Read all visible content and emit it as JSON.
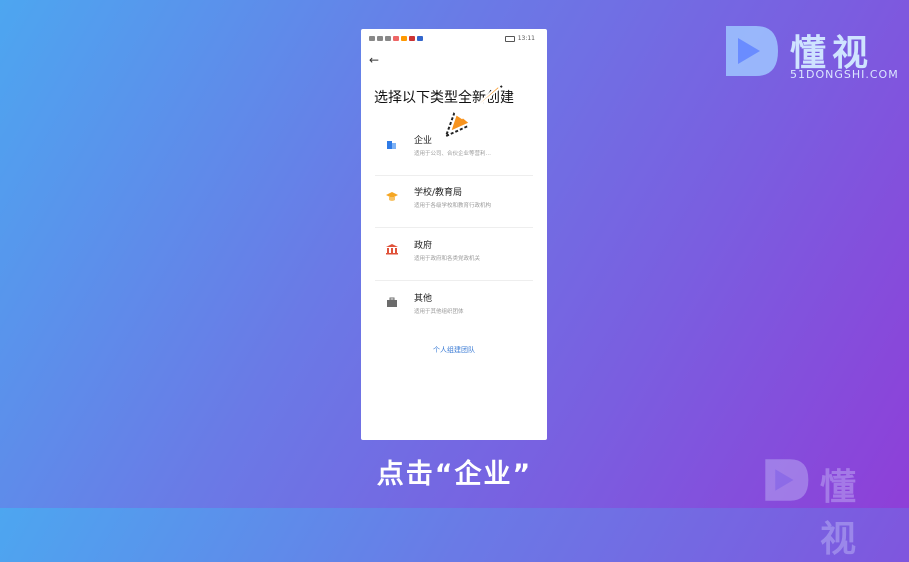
{
  "logo": {
    "text": "懂视",
    "sub": "51DONGSHI.COM"
  },
  "watermark": {
    "text": "懂视"
  },
  "phone": {
    "status_time": "13:11",
    "heading": "选择以下类型全新创建",
    "items": [
      {
        "title": "企业",
        "desc": "适用于公司、合伙企业等营利…",
        "icon": "building-icon",
        "icon_color": "#2f7be6"
      },
      {
        "title": "学校/教育局",
        "desc": "适用于各级学校和教育行政机构",
        "icon": "graduation-cap-icon",
        "icon_color": "#f5a623"
      },
      {
        "title": "政府",
        "desc": "适用于政府和各类党政机关",
        "icon": "government-icon",
        "icon_color": "#e0523a"
      },
      {
        "title": "其他",
        "desc": "适用于其他组织团体",
        "icon": "briefcase-icon",
        "icon_color": "#6b6b6b"
      }
    ],
    "personal_link": "个人组建团队"
  },
  "caption": "点击“企业”",
  "colors": {
    "arrow": "#f7931e",
    "link": "#3a7bd5"
  }
}
